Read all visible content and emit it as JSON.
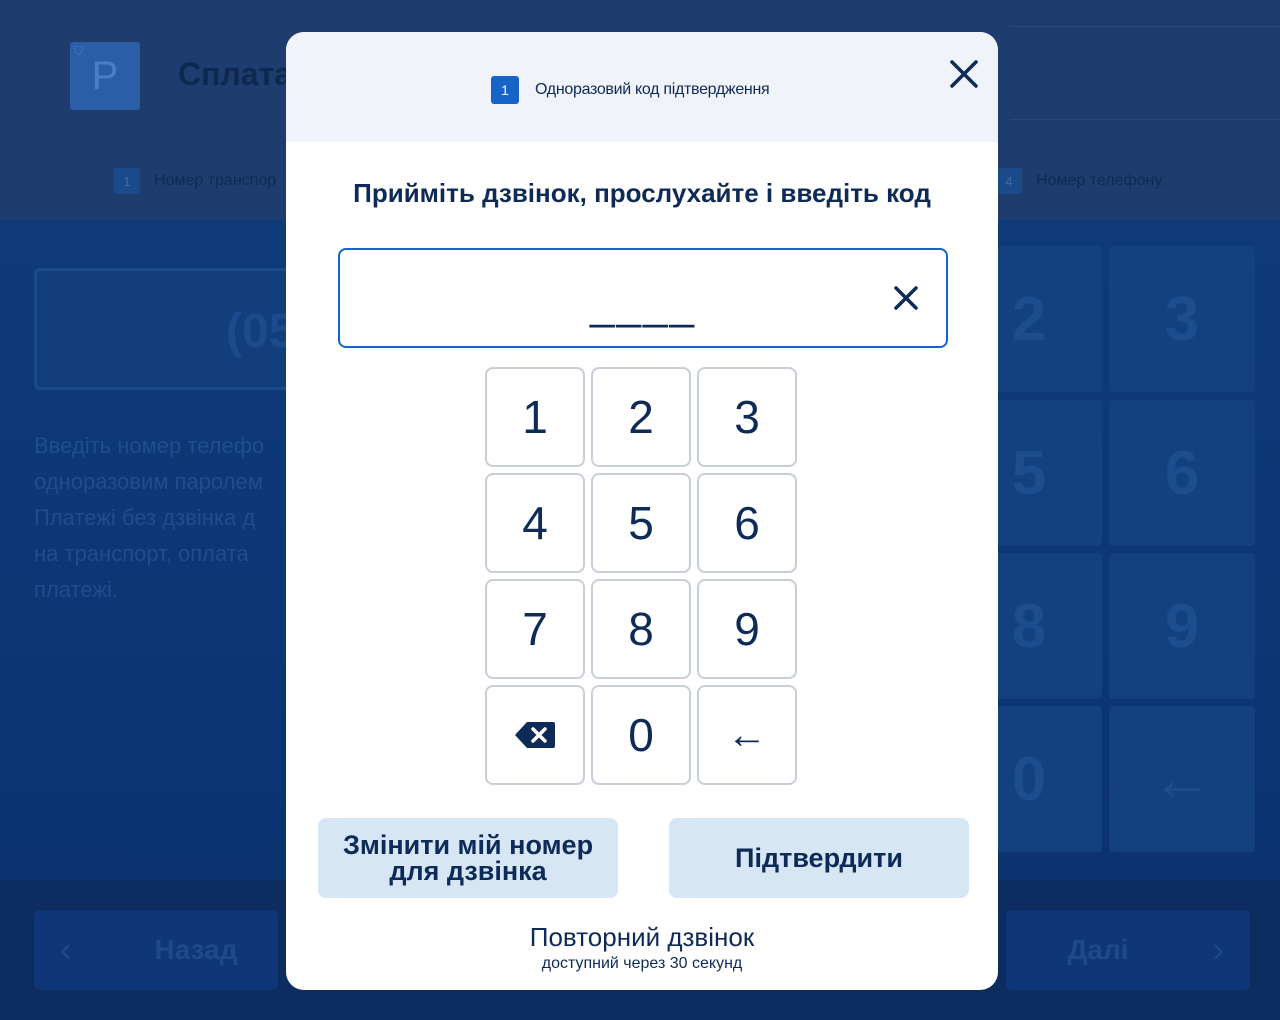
{
  "background": {
    "logo_letter": "P",
    "title": "Сплата",
    "steps": [
      {
        "num": "1",
        "label": "Номер транспор"
      },
      {
        "num": "4",
        "label": "Номер телефону:"
      }
    ],
    "phone_value": "(05",
    "description": "Введіть номер телефо\nодноразовим паролем\nПлатежі без дзвінка д\nна транспорт, оплата \nплатежі.",
    "keypad": [
      "2",
      "3",
      "5",
      "6",
      "8",
      "9",
      "0",
      "←"
    ],
    "back_label": "Назад",
    "next_label": "Далі"
  },
  "modal": {
    "step_num": "1",
    "step_label": "Одноразовий код підтвердження",
    "instruction": "Прийміть дзвінок, прослухайте і введіть код",
    "code_mask": "____",
    "keys": [
      "1",
      "2",
      "3",
      "4",
      "5",
      "6",
      "7",
      "8",
      "9",
      "0",
      "←"
    ],
    "change_number_label_line1": "Змінити мій номер",
    "change_number_label_line2": "для дзвінка",
    "confirm_label": "Підтвердити",
    "resend_title": "Повторний дзвінок",
    "resend_subtitle": "доступний через 30 секунд"
  },
  "icons": {
    "close": "close-icon",
    "clear": "clear-icon",
    "backspace": "backspace-icon"
  },
  "colors": {
    "accent": "#1664c8",
    "text": "#0e2a57",
    "button_bg": "#d7e6f5",
    "overlay_bg": "#1d3b6c"
  }
}
